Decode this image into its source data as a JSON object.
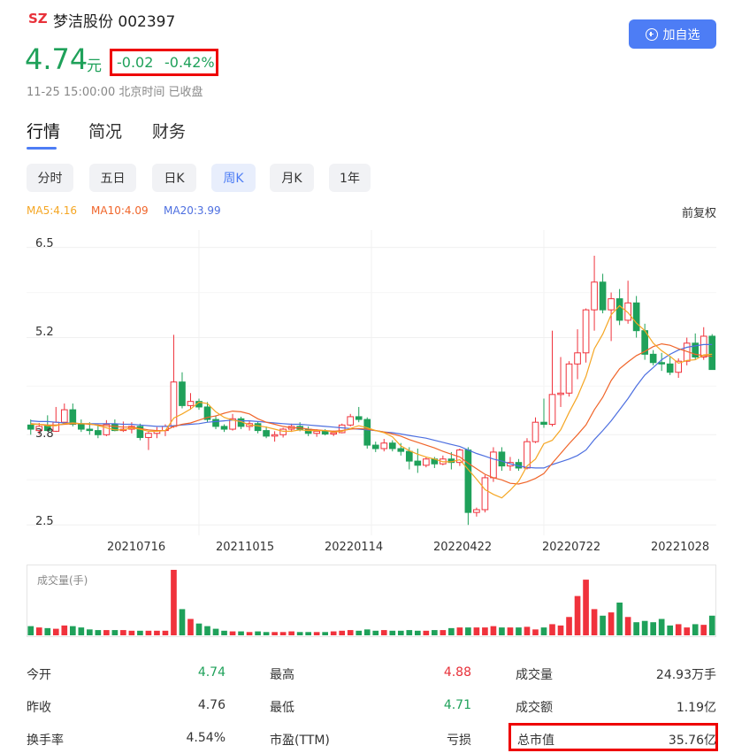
{
  "header": {
    "market": "SZ",
    "stock_name": "梦洁股份",
    "stock_code": "002397",
    "price": "4.74",
    "unit": "元",
    "change": "-0.02",
    "change_pct": "-0.42%",
    "time_status": "11-25 15:00:00 北京时间 已收盘",
    "add_label": "加自选"
  },
  "tabs": [
    {
      "label": "行情",
      "active": true
    },
    {
      "label": "简况",
      "active": false
    },
    {
      "label": "财务",
      "active": false
    }
  ],
  "periods": [
    {
      "label": "分时",
      "active": false
    },
    {
      "label": "五日",
      "active": false
    },
    {
      "label": "日K",
      "active": false
    },
    {
      "label": "周K",
      "active": true
    },
    {
      "label": "月K",
      "active": false
    },
    {
      "label": "1年",
      "active": false
    }
  ],
  "ma_legend": {
    "ma5": "MA5:4.16",
    "ma10": "MA10:4.09",
    "ma20": "MA20:3.99",
    "adjust": "前复权",
    "colors": {
      "ma5": "#f5a623",
      "ma10": "#f0652a",
      "ma20": "#4d6fe0"
    }
  },
  "chart_data": {
    "type": "candlestick",
    "y_ticks": [
      "6.5",
      "5.2",
      "3.8",
      "2.5"
    ],
    "x_ticks": [
      "20210716",
      "20211015",
      "20220114",
      "20220422",
      "20220722",
      "20221028"
    ],
    "ylim": [
      2.35,
      6.75
    ],
    "up_color": "#f0323c",
    "down_color": "#1fa15a",
    "volume_title": "成交量(手)",
    "candles": [
      [
        3.94,
        4.02,
        3.8,
        3.88
      ],
      [
        3.86,
        3.97,
        3.8,
        3.92
      ],
      [
        3.93,
        4.08,
        3.85,
        3.86
      ],
      [
        3.85,
        4.2,
        3.84,
        3.98
      ],
      [
        3.98,
        4.25,
        3.95,
        4.16
      ],
      [
        4.16,
        4.25,
        3.92,
        3.95
      ],
      [
        3.95,
        4.02,
        3.84,
        3.88
      ],
      [
        3.88,
        3.98,
        3.8,
        3.86
      ],
      [
        3.86,
        3.95,
        3.75,
        3.8
      ],
      [
        3.8,
        4.01,
        3.78,
        3.95
      ],
      [
        3.95,
        4.02,
        3.85,
        3.86
      ],
      [
        3.86,
        3.99,
        3.84,
        3.88
      ],
      [
        3.88,
        3.98,
        3.82,
        3.92
      ],
      [
        3.92,
        3.96,
        3.72,
        3.76
      ],
      [
        3.76,
        3.84,
        3.58,
        3.82
      ],
      [
        3.82,
        3.91,
        3.75,
        3.86
      ],
      [
        3.86,
        3.95,
        3.78,
        3.92
      ],
      [
        3.92,
        5.24,
        3.9,
        4.56
      ],
      [
        4.56,
        4.7,
        4.18,
        4.22
      ],
      [
        4.22,
        4.4,
        4.16,
        4.28
      ],
      [
        4.28,
        4.32,
        4.16,
        4.2
      ],
      [
        4.2,
        4.27,
        3.98,
        4.02
      ],
      [
        4.02,
        4.08,
        3.88,
        3.92
      ],
      [
        3.92,
        3.95,
        3.84,
        3.88
      ],
      [
        3.88,
        4.1,
        3.86,
        4.03
      ],
      [
        4.03,
        4.06,
        3.88,
        3.92
      ],
      [
        3.92,
        4.0,
        3.86,
        3.96
      ],
      [
        3.96,
        3.99,
        3.82,
        3.86
      ],
      [
        3.86,
        3.92,
        3.75,
        3.78
      ],
      [
        3.78,
        3.85,
        3.7,
        3.8
      ],
      [
        3.8,
        3.9,
        3.76,
        3.88
      ],
      [
        3.88,
        3.96,
        3.84,
        3.92
      ],
      [
        3.92,
        3.98,
        3.85,
        3.88
      ],
      [
        3.88,
        3.92,
        3.78,
        3.82
      ],
      [
        3.82,
        3.88,
        3.77,
        3.85
      ],
      [
        3.85,
        3.88,
        3.79,
        3.81
      ],
      [
        3.81,
        3.86,
        3.78,
        3.83
      ],
      [
        3.83,
        3.96,
        3.82,
        3.94
      ],
      [
        3.94,
        4.1,
        3.92,
        4.06
      ],
      [
        4.06,
        4.2,
        3.98,
        4.02
      ],
      [
        4.02,
        4.05,
        3.6,
        3.65
      ],
      [
        3.65,
        3.7,
        3.55,
        3.6
      ],
      [
        3.6,
        3.74,
        3.56,
        3.68
      ],
      [
        3.68,
        3.72,
        3.56,
        3.6
      ],
      [
        3.6,
        3.68,
        3.5,
        3.56
      ],
      [
        3.56,
        3.62,
        3.3,
        3.42
      ],
      [
        3.42,
        3.6,
        3.25,
        3.36
      ],
      [
        3.36,
        3.48,
        3.33,
        3.45
      ],
      [
        3.45,
        3.48,
        3.32,
        3.38
      ],
      [
        3.38,
        3.5,
        3.36,
        3.45
      ],
      [
        3.45,
        3.55,
        3.3,
        3.4
      ],
      [
        3.4,
        3.6,
        3.35,
        3.58
      ],
      [
        3.58,
        3.62,
        2.5,
        2.68
      ],
      [
        2.68,
        2.75,
        2.62,
        2.72
      ],
      [
        2.72,
        3.22,
        2.68,
        3.18
      ],
      [
        3.18,
        3.62,
        3.12,
        3.55
      ],
      [
        3.55,
        3.62,
        3.28,
        3.35
      ],
      [
        3.35,
        3.48,
        3.28,
        3.4
      ],
      [
        3.4,
        3.45,
        3.28,
        3.32
      ],
      [
        3.32,
        3.75,
        3.3,
        3.7
      ],
      [
        3.7,
        4.05,
        3.68,
        3.98
      ],
      [
        3.98,
        4.32,
        3.9,
        3.95
      ],
      [
        3.95,
        5.3,
        3.92,
        4.38
      ],
      [
        4.38,
        4.92,
        4.2,
        4.4
      ],
      [
        4.4,
        4.86,
        4.35,
        4.82
      ],
      [
        4.82,
        5.32,
        4.6,
        4.98
      ],
      [
        4.98,
        5.62,
        4.84,
        5.6
      ],
      [
        5.6,
        6.38,
        5.3,
        6.0
      ],
      [
        6.0,
        6.12,
        5.55,
        5.6
      ],
      [
        5.6,
        5.85,
        5.15,
        5.76
      ],
      [
        5.76,
        5.9,
        5.38,
        5.45
      ],
      [
        5.45,
        6.02,
        5.4,
        5.7
      ],
      [
        5.7,
        5.8,
        5.2,
        5.3
      ],
      [
        5.3,
        5.4,
        4.88,
        4.96
      ],
      [
        4.96,
        5.02,
        4.8,
        4.84
      ],
      [
        4.84,
        4.98,
        4.72,
        4.82
      ],
      [
        4.82,
        4.92,
        4.66,
        4.7
      ],
      [
        4.7,
        4.9,
        4.62,
        4.86
      ],
      [
        4.86,
        5.2,
        4.8,
        5.12
      ],
      [
        5.12,
        5.26,
        4.88,
        4.92
      ],
      [
        4.92,
        5.35,
        4.88,
        5.22
      ],
      [
        5.22,
        5.25,
        4.82,
        4.74
      ]
    ],
    "ma5": [
      3.95,
      3.95,
      3.93,
      3.93,
      3.96,
      3.97,
      3.96,
      3.96,
      3.93,
      3.9,
      3.87,
      3.87,
      3.9,
      3.88,
      3.85,
      3.85,
      3.86,
      4.04,
      4.1,
      4.17,
      4.27,
      4.25,
      4.13,
      4.05,
      4.01,
      3.99,
      3.94,
      3.93,
      3.91,
      3.88,
      3.85,
      3.85,
      3.87,
      3.86,
      3.86,
      3.86,
      3.84,
      3.85,
      3.89,
      3.93,
      3.9,
      3.86,
      3.83,
      3.77,
      3.64,
      3.57,
      3.52,
      3.48,
      3.45,
      3.41,
      3.41,
      3.44,
      3.3,
      3.16,
      3.01,
      2.94,
      2.89,
      3.0,
      3.13,
      3.35,
      3.45,
      3.67,
      3.72,
      3.87,
      4.12,
      4.35,
      4.64,
      5.04,
      5.25,
      5.53,
      5.66,
      5.56,
      5.41,
      5.3,
      5.12,
      5.01,
      4.93,
      4.83,
      4.87,
      4.88,
      4.95,
      4.96
    ],
    "ma10": [
      3.96,
      3.95,
      3.94,
      3.94,
      3.95,
      3.96,
      3.96,
      3.95,
      3.94,
      3.93,
      3.92,
      3.91,
      3.91,
      3.89,
      3.87,
      3.86,
      3.86,
      3.92,
      3.95,
      3.97,
      4.01,
      4.05,
      4.07,
      4.11,
      4.14,
      4.13,
      4.1,
      4.03,
      3.98,
      3.95,
      3.92,
      3.9,
      3.9,
      3.88,
      3.87,
      3.86,
      3.85,
      3.86,
      3.88,
      3.89,
      3.88,
      3.86,
      3.84,
      3.81,
      3.78,
      3.73,
      3.69,
      3.65,
      3.61,
      3.56,
      3.52,
      3.48,
      3.39,
      3.31,
      3.23,
      3.18,
      3.15,
      3.1,
      3.09,
      3.12,
      3.17,
      3.24,
      3.39,
      3.53,
      3.67,
      3.8,
      3.94,
      4.16,
      4.34,
      4.58,
      4.75,
      4.85,
      4.94,
      5.0,
      5.07,
      5.11,
      5.09,
      5.04,
      5.0,
      4.96,
      4.94,
      4.93
    ],
    "ma20": [
      4.0,
      3.99,
      3.99,
      3.98,
      3.97,
      3.97,
      3.96,
      3.96,
      3.96,
      3.96,
      3.96,
      3.95,
      3.95,
      3.94,
      3.93,
      3.92,
      3.92,
      3.93,
      3.94,
      3.95,
      3.96,
      3.98,
      3.99,
      4.0,
      4.01,
      4.0,
      4.0,
      3.99,
      3.98,
      3.97,
      3.96,
      3.95,
      3.95,
      3.94,
      3.93,
      3.92,
      3.91,
      3.9,
      3.89,
      3.88,
      3.87,
      3.86,
      3.84,
      3.83,
      3.81,
      3.79,
      3.77,
      3.75,
      3.72,
      3.69,
      3.66,
      3.63,
      3.58,
      3.53,
      3.49,
      3.45,
      3.42,
      3.38,
      3.35,
      3.33,
      3.32,
      3.32,
      3.37,
      3.41,
      3.45,
      3.5,
      3.58,
      3.73,
      3.86,
      4.0,
      4.16,
      4.32,
      4.5,
      4.66,
      4.77,
      4.88,
      4.96,
      5.02,
      5.06,
      5.08,
      5.1,
      5.1
    ],
    "volumes": [
      14,
      12,
      11,
      10,
      15,
      14,
      12,
      9,
      8,
      8,
      8,
      8,
      7,
      7,
      7,
      7,
      7,
      100,
      40,
      25,
      18,
      14,
      10,
      7,
      6,
      6,
      5,
      6,
      5,
      5,
      5,
      6,
      5,
      5,
      5,
      5,
      6,
      7,
      8,
      7,
      9,
      7,
      8,
      7,
      7,
      8,
      7,
      7,
      8,
      8,
      11,
      12,
      12,
      12,
      12,
      14,
      12,
      12,
      12,
      13,
      9,
      12,
      17,
      15,
      28,
      60,
      85,
      40,
      30,
      35,
      50,
      28,
      20,
      22,
      20,
      25,
      15,
      17,
      12,
      17,
      16,
      30
    ],
    "volume_max": 100
  },
  "stats": [
    [
      {
        "label": "今开",
        "value": "4.74",
        "color": "#1fa15a"
      },
      {
        "label": "最高",
        "value": "4.88",
        "color": "#e8313a"
      },
      {
        "label": "成交量",
        "value": "24.93万手",
        "color": "#333"
      }
    ],
    [
      {
        "label": "昨收",
        "value": "4.76",
        "color": "#333"
      },
      {
        "label": "最低",
        "value": "4.71",
        "color": "#1fa15a"
      },
      {
        "label": "成交额",
        "value": "1.19亿",
        "color": "#333"
      }
    ],
    [
      {
        "label": "换手率",
        "value": "4.54%",
        "color": "#333"
      },
      {
        "label": "市盈(TTM)",
        "value": "亏损",
        "color": "#333"
      },
      {
        "label": "总市值",
        "value": "35.76亿",
        "color": "#333"
      }
    ]
  ]
}
